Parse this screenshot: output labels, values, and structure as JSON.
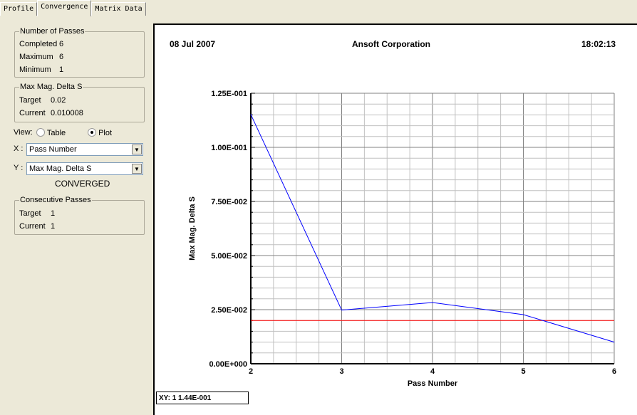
{
  "tabs": [
    "Profile",
    "Convergence",
    "Matrix Data"
  ],
  "passes": {
    "title": "Number of Passes",
    "completed_label": "Completed",
    "completed": "6",
    "maximum_label": "Maximum",
    "maximum": "6",
    "minimum_label": "Minimum",
    "minimum": "1"
  },
  "delta": {
    "title": "Max Mag. Delta S",
    "target_label": "Target",
    "target": "0.02",
    "current_label": "Current",
    "current": "0.010008"
  },
  "view": {
    "label": "View:",
    "table": "Table",
    "plot": "Plot",
    "selected": "Plot"
  },
  "x_select": {
    "label": "X :",
    "value": "Pass Number"
  },
  "y_select": {
    "label": "Y :",
    "value": "Max Mag. Delta S"
  },
  "status": "CONVERGED",
  "consecutive": {
    "title": "Consecutive Passes",
    "target_label": "Target",
    "target": "1",
    "current_label": "Current",
    "current": "1"
  },
  "plot_header": {
    "date": "08 Jul 2007",
    "company": "Ansoft Corporation",
    "time": "18:02:13"
  },
  "xy_readout": "XY: 1 1.44E-001",
  "colors": {
    "series": "#0000ff",
    "target_line": "#ff0000"
  },
  "chart_data": {
    "type": "line",
    "xlabel": "Pass Number",
    "ylabel": "Max Mag. Delta S",
    "xlim": [
      2,
      6
    ],
    "ylim": [
      0,
      0.125
    ],
    "grid": true,
    "x_ticks": [
      "2",
      "3",
      "4",
      "5",
      "6"
    ],
    "y_ticks": [
      "0.00E+000",
      "2.50E-002",
      "5.00E-002",
      "7.50E-002",
      "1.00E-001",
      "1.25E-001"
    ],
    "x": [
      2,
      3,
      4,
      5,
      6
    ],
    "values": [
      0.1152,
      0.0248,
      0.0283,
      0.0227,
      0.01
    ],
    "target_line": 0.02
  }
}
